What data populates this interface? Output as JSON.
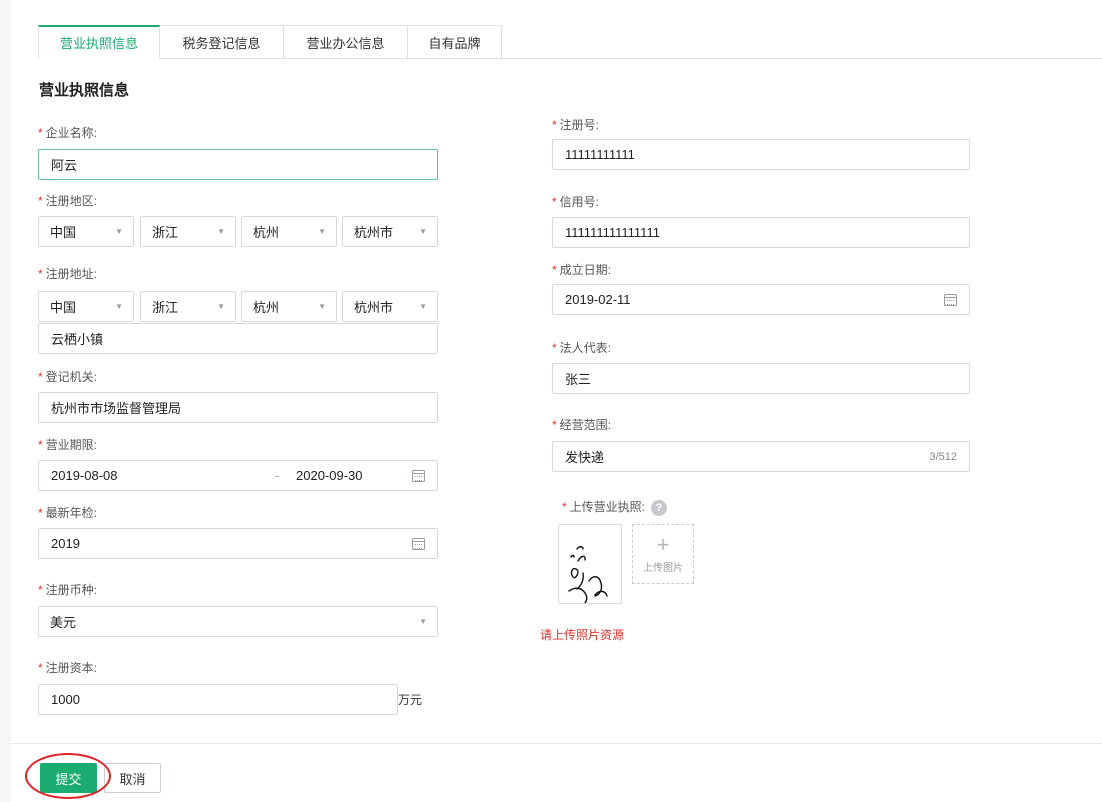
{
  "tabs": [
    "营业执照信息",
    "税务登记信息",
    "营业办公信息",
    "自有品牌"
  ],
  "section_title": "营业执照信息",
  "required_mark": "*",
  "left": {
    "company_name": {
      "label": "企业名称:",
      "value": "阿云"
    },
    "reg_region": {
      "label": "注册地区:",
      "country": "中国",
      "province": "浙江",
      "city": "杭州",
      "district": "杭州市"
    },
    "reg_address": {
      "label": "注册地址:",
      "country": "中国",
      "province": "浙江",
      "city": "杭州",
      "district": "杭州市",
      "detail": "云栖小镇"
    },
    "authority": {
      "label": "登记机关:",
      "value": "杭州市市场监督管理局"
    },
    "term": {
      "label": "营业期限:",
      "start": "2019-08-08",
      "separator": "-",
      "end": "2020-09-30"
    },
    "annual_check": {
      "label": "最新年检:",
      "value": "2019"
    },
    "currency": {
      "label": "注册币种:",
      "value": "美元"
    },
    "capital": {
      "label": "注册资本:",
      "value": "1000",
      "unit": "万元"
    }
  },
  "right": {
    "reg_no": {
      "label": "注册号:",
      "value": "11111111111"
    },
    "credit_no": {
      "label": "信用号:",
      "value": "111111111111111"
    },
    "founded": {
      "label": "成立日期:",
      "value": "2019-02-11"
    },
    "legal_rep": {
      "label": "法人代表:",
      "value": "张三"
    },
    "scope": {
      "label": "经营范围:",
      "value": "发快递",
      "counter": "3/512"
    },
    "license": {
      "label": "上传营业执照:",
      "help": "?",
      "upload_text": "上传图片",
      "error": "请上传照片资源"
    }
  },
  "icons": {
    "caret": "▼",
    "plus": "+"
  },
  "buttons": {
    "submit": "提交",
    "cancel": "取消"
  },
  "colors": {
    "primary": "#1aad6f",
    "required": "#e5322d",
    "highlight_ring": "#e02020"
  }
}
